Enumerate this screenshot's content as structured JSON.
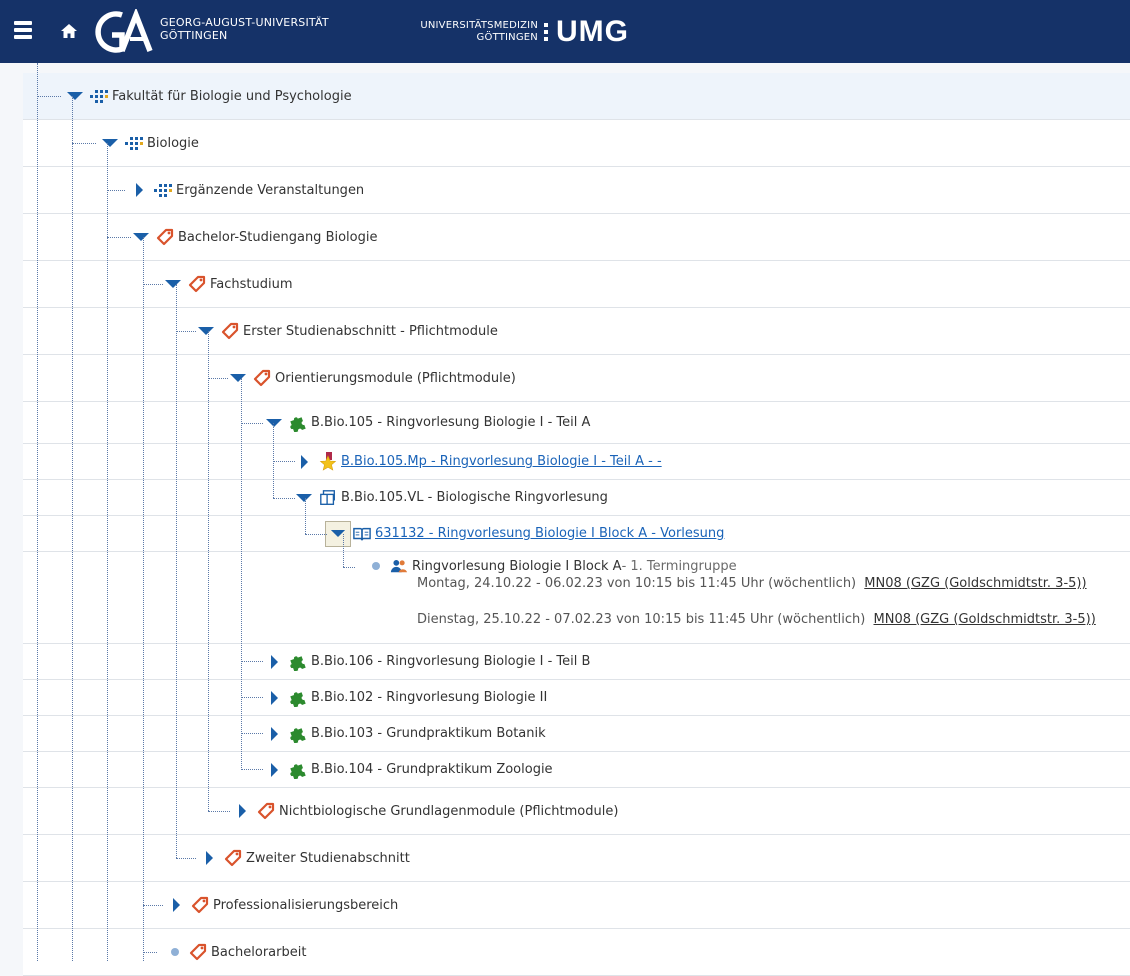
{
  "header": {
    "ga_name_line1": "GEORG-AUGUST-UNIVERSITÄT",
    "ga_name_line2": "GÖTTINGEN",
    "umg_line1": "UNIVERSITÄTSMEDIZIN",
    "umg_line2": "GÖTTINGEN",
    "umg_word": "UMG"
  },
  "tree": {
    "fakultaet": "Fakultät für Biologie und Psychologie",
    "biologie": "Biologie",
    "ergaenzend": "Ergänzende Veranstaltungen",
    "bachelor": "Bachelor-Studiengang Biologie",
    "fachstudium": "Fachstudium",
    "erster": "Erster Studienabschnitt - Pflichtmodule",
    "orientierung": "Orientierungsmodule (Pflichtmodule)",
    "bio105": "B.Bio.105 - Ringvorlesung Biologie I - Teil A",
    "bio105mp": "B.Bio.105.Mp - Ringvorlesung Biologie I - Teil A - -",
    "bio105vl": "B.Bio.105.VL - Biologische Ringvorlesung",
    "vorlesung": "631132 - Ringvorlesung Biologie I Block A - Vorlesung",
    "gruppe_title": "Ringvorlesung Biologie I Block A",
    "gruppe_suffix": " - 1. Termingruppe",
    "termin1": "Montag, 24.10.22 - 06.02.23 von 10:15 bis 11:45 Uhr (wöchentlich)",
    "room1": "MN08 (GZG (Goldschmidtstr. 3-5))",
    "termin2": "Dienstag, 25.10.22 - 07.02.23 von 10:15 bis 11:45 Uhr (wöchentlich)",
    "room2": "MN08 (GZG (Goldschmidtstr. 3-5))",
    "bio106": "B.Bio.106 - Ringvorlesung Biologie I - Teil B",
    "bio102": "B.Bio.102 - Ringvorlesung Biologie II",
    "bio103": "B.Bio.103 - Grundpraktikum Botanik",
    "bio104": "B.Bio.104 - Grundpraktikum Zoologie",
    "nichtbio": "Nichtbiologische Grundlagenmodule (Pflichtmodule)",
    "zweiter": "Zweiter Studienabschnitt",
    "professional": "Professionalisierungsbereich",
    "bachelorarbeit": "Bachelorarbeit"
  },
  "colors": {
    "header_bg": "#153268",
    "toggle_blue": "#1a5fa8",
    "tag_red": "#d9532c",
    "module_green": "#2c8a2e",
    "link_blue": "#1a63b8"
  }
}
